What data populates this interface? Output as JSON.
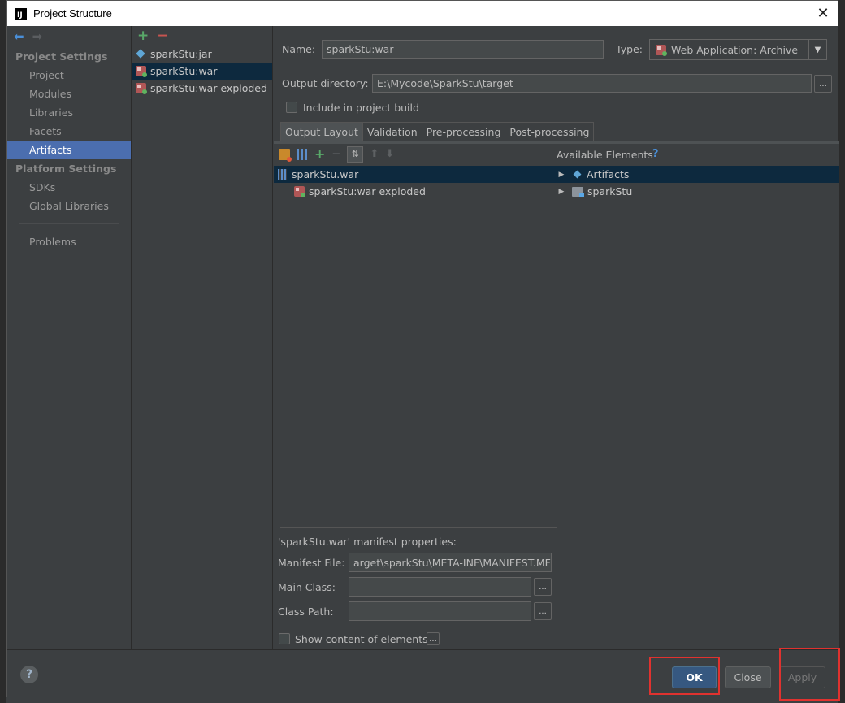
{
  "window": {
    "title": "Project Structure",
    "close_glyph": "✕"
  },
  "nav": {
    "sections": [
      {
        "header": "Project Settings",
        "items": [
          "Project",
          "Modules",
          "Libraries",
          "Facets",
          "Artifacts"
        ]
      },
      {
        "header": "Platform Settings",
        "items": [
          "SDKs",
          "Global Libraries"
        ]
      }
    ],
    "extra_item": "Problems",
    "selected": "Artifacts"
  },
  "artifacts": {
    "items": [
      "sparkStu:jar",
      "sparkStu:war",
      "sparkStu:war exploded"
    ],
    "selected": "sparkStu:war"
  },
  "form": {
    "name_label": "Name:",
    "name_value": "sparkStu:war",
    "type_label": "Type:",
    "type_value": "Web Application: Archive",
    "output_label": "Output directory:",
    "output_value": "E:\\Mycode\\SparkStu\\target",
    "include_label": "Include in project build",
    "include_checked": false
  },
  "tabs": [
    "Output Layout",
    "Validation",
    "Pre-processing",
    "Post-processing"
  ],
  "active_tab": "Output Layout",
  "layout": {
    "tree_root": "sparkStu.war",
    "tree_child": "sparkStu:war exploded",
    "available_title": "Available Elements",
    "available_items": [
      "Artifacts",
      "sparkStu"
    ]
  },
  "manifest": {
    "title": "'sparkStu.war' manifest properties:",
    "file_label": "Manifest File:",
    "file_value": "arget\\sparkStu\\META-INF\\MANIFEST.MF",
    "main_class_label": "Main Class:",
    "main_class_value": "",
    "class_path_label": "Class Path:",
    "class_path_value": "",
    "show_content_label": "Show content of elements"
  },
  "buttons": {
    "ok": "OK",
    "close": "Close",
    "apply": "Apply",
    "help": "?",
    "ellipsis": "..."
  },
  "colors": {
    "background": "#3c3f41",
    "selection": "#4b6eaf",
    "tree_selection": "#0d293e",
    "ok_button": "#365880",
    "highlight_box": "#e0322f"
  }
}
